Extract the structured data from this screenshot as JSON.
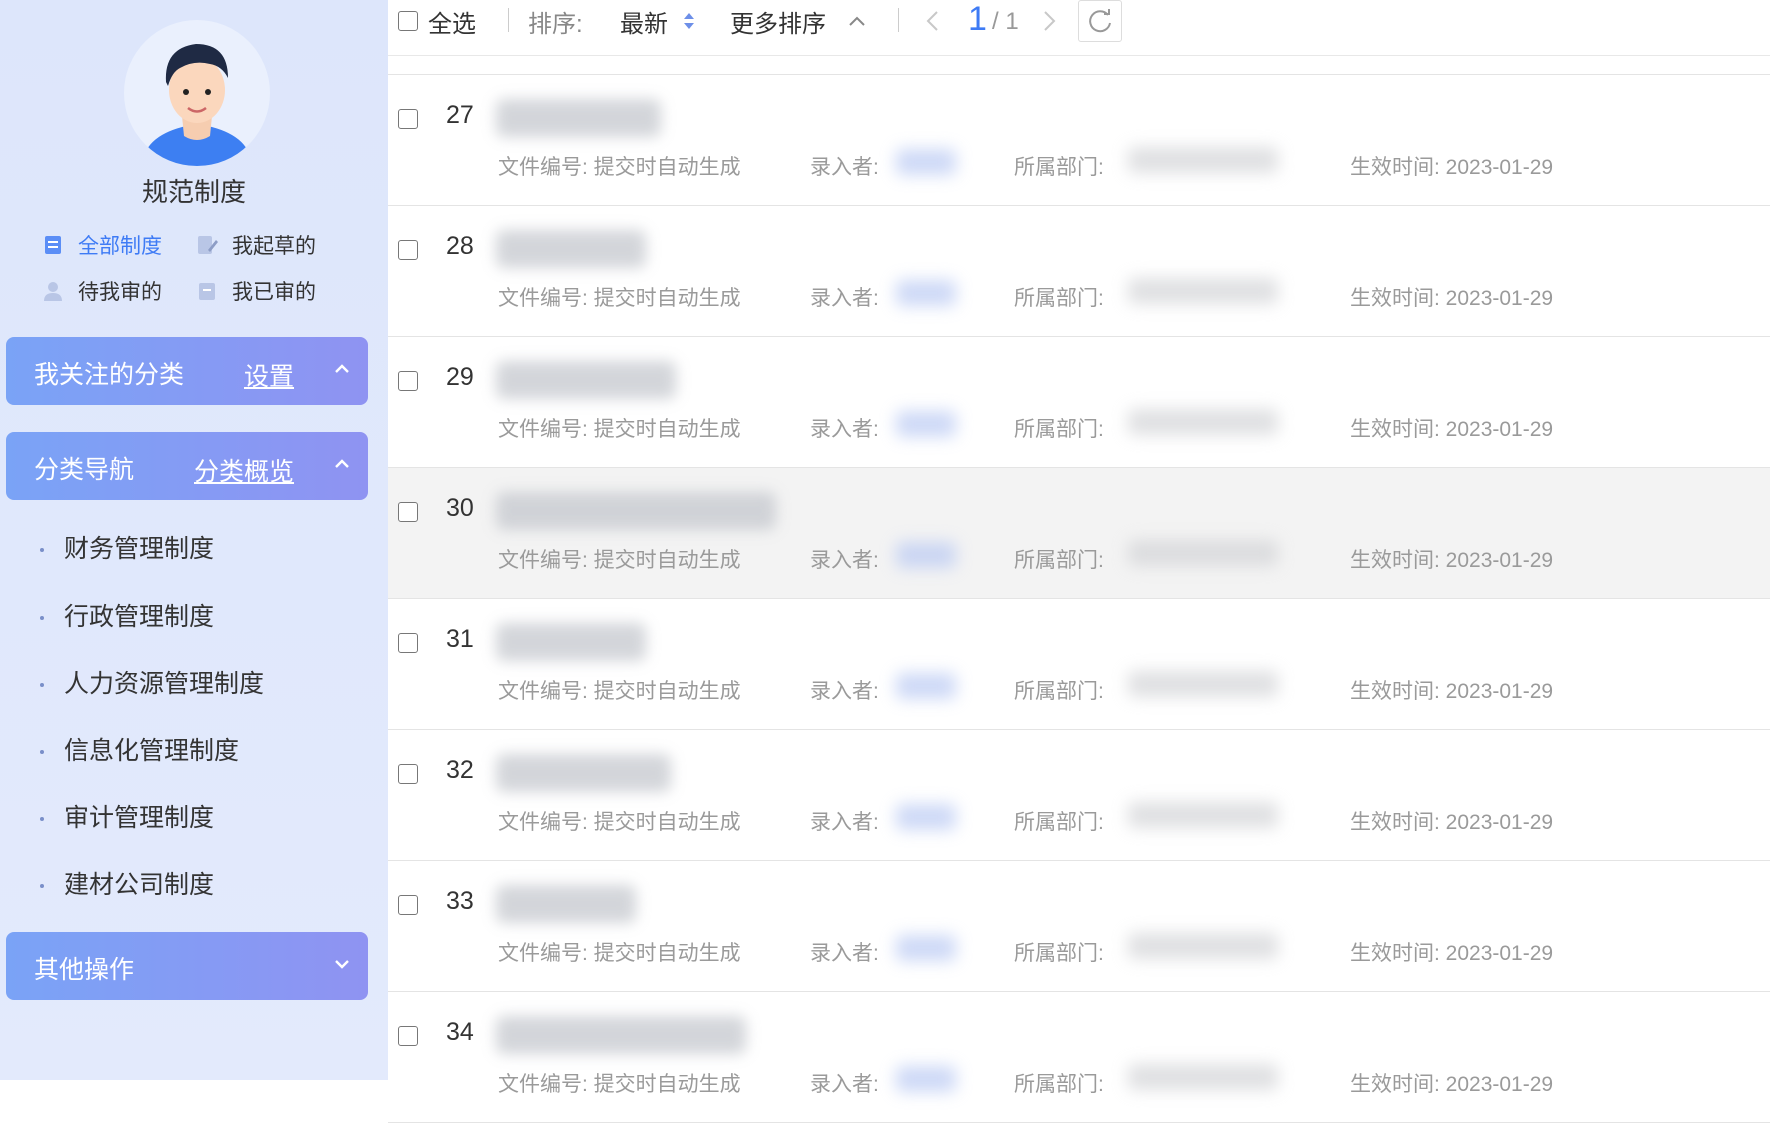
{
  "sidebar": {
    "profile_title": "规范制度",
    "quick_links": [
      {
        "label": "全部制度",
        "active": true,
        "icon": "doc-list-icon"
      },
      {
        "label": "我起草的",
        "active": false,
        "icon": "edit-doc-icon"
      },
      {
        "label": "待我审的",
        "active": false,
        "icon": "user-icon"
      },
      {
        "label": "我已审的",
        "active": false,
        "icon": "archive-icon"
      }
    ],
    "followed_panel": {
      "title": "我关注的分类",
      "link": "设置"
    },
    "nav_panel": {
      "title": "分类导航",
      "link": "分类概览"
    },
    "categories": [
      "财务管理制度",
      "行政管理制度",
      "人力资源管理制度",
      "信息化管理制度",
      "审计管理制度",
      "建材公司制度"
    ],
    "other_panel": {
      "title": "其他操作"
    }
  },
  "toolbar": {
    "select_all": "全选",
    "sort_label": "排序:",
    "sort_value": "最新",
    "more_sort": "更多排序",
    "page_current": "1",
    "page_total": "/ 1"
  },
  "rows": [
    {
      "num": "27",
      "doc_no": "文件编号: 提交时自动生成",
      "creator_label": "录入者:",
      "dept_label": "所属部门:",
      "effective": "生效时间: 2023-01-29"
    },
    {
      "num": "28",
      "doc_no": "文件编号: 提交时自动生成",
      "creator_label": "录入者:",
      "dept_label": "所属部门:",
      "effective": "生效时间: 2023-01-29"
    },
    {
      "num": "29",
      "doc_no": "文件编号: 提交时自动生成",
      "creator_label": "录入者:",
      "dept_label": "所属部门:",
      "effective": "生效时间: 2023-01-29"
    },
    {
      "num": "30",
      "doc_no": "文件编号: 提交时自动生成",
      "creator_label": "录入者:",
      "dept_label": "所属部门:",
      "effective": "生效时间: 2023-01-29"
    },
    {
      "num": "31",
      "doc_no": "文件编号: 提交时自动生成",
      "creator_label": "录入者:",
      "dept_label": "所属部门:",
      "effective": "生效时间: 2023-01-29"
    },
    {
      "num": "32",
      "doc_no": "文件编号: 提交时自动生成",
      "creator_label": "录入者:",
      "dept_label": "所属部门:",
      "effective": "生效时间: 2023-01-29"
    },
    {
      "num": "33",
      "doc_no": "文件编号: 提交时自动生成",
      "creator_label": "录入者:",
      "dept_label": "所属部门:",
      "effective": "生效时间: 2023-01-29"
    },
    {
      "num": "34",
      "doc_no": "文件编号: 提交时自动生成",
      "creator_label": "录入者:",
      "dept_label": "所属部门:",
      "effective": "生效时间: 2023-01-29"
    }
  ],
  "colors": {
    "accent": "#3e7bf5",
    "panel_start": "#7aa3f6",
    "panel_end": "#8f93f2",
    "sidebar_bg": "#e0e8fb"
  }
}
